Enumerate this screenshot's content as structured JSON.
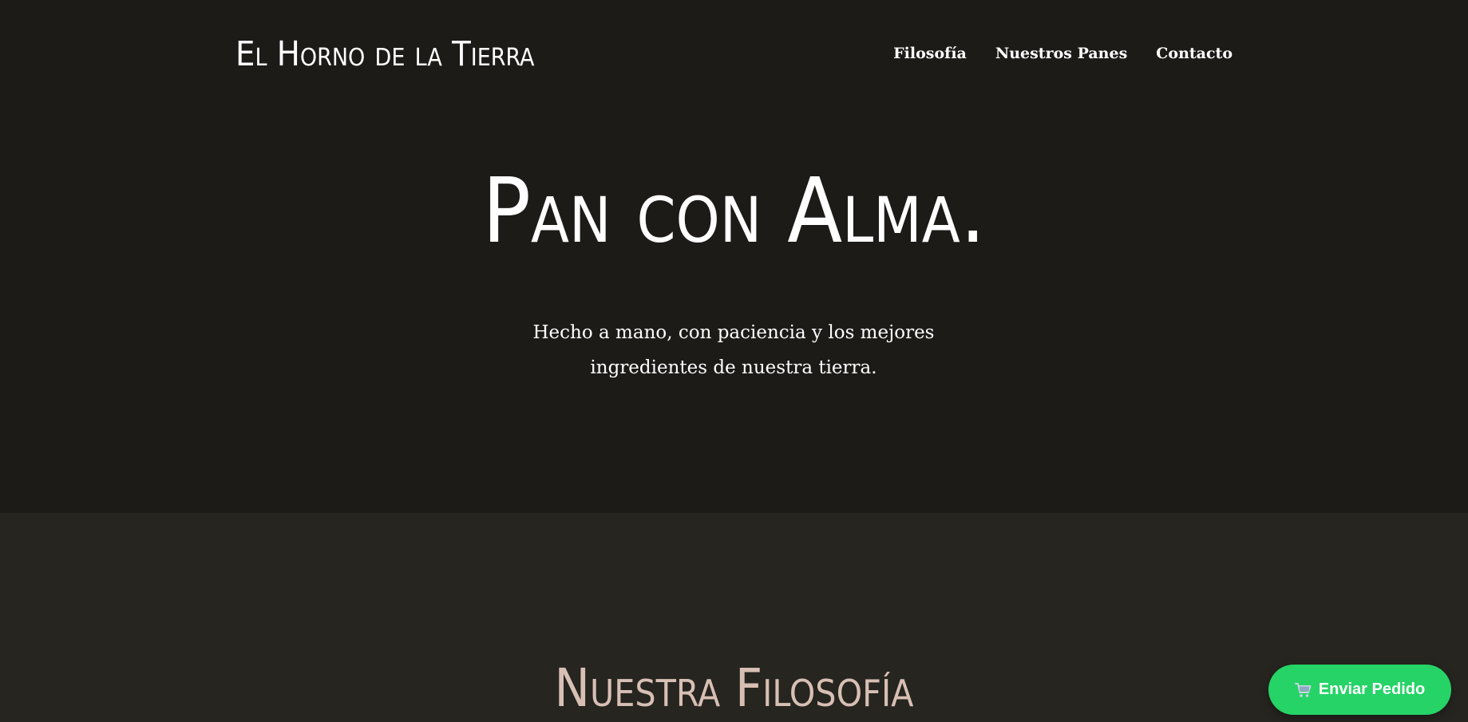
{
  "header": {
    "logo": "El Horno de la Tierra",
    "nav": [
      {
        "label": "Filosofía"
      },
      {
        "label": "Nuestros Panes"
      },
      {
        "label": "Contacto"
      }
    ]
  },
  "hero": {
    "title": "Pan con Alma.",
    "subtitle": "Hecho a mano, con paciencia y los mejores ingredientes de nuestra tierra."
  },
  "philosophy": {
    "title": "Nuestra Filosofía"
  },
  "order_button": {
    "icon": "shopping-cart-icon",
    "label": "Enviar Pedido"
  },
  "colors": {
    "background": "#1c1b18",
    "section_background": "#262520",
    "section_title": "#d8bfb4",
    "order_button": "#25d366"
  }
}
